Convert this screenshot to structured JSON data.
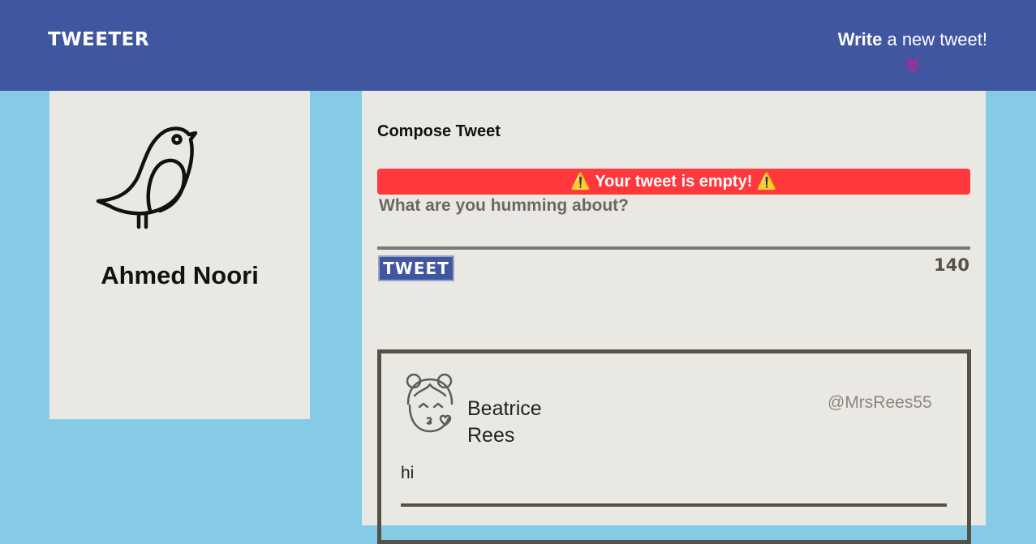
{
  "header": {
    "brand": "TWEETER",
    "write_bold": "Write",
    "write_rest": " a new tweet!"
  },
  "profile": {
    "name": "Ahmed Noori"
  },
  "compose": {
    "title": "Compose Tweet",
    "error": "⚠️ Your tweet is empty! ⚠️",
    "placeholder": "What are you humming about?",
    "button_label": "TWEET",
    "counter": "140"
  },
  "tweets": [
    {
      "name": "Beatrice Rees",
      "handle": "@MrsRees55",
      "text": "hi"
    }
  ],
  "icons": {
    "profile_avatar": "bird-icon",
    "toggle": "double-chevron-down-icon",
    "tweet_avatar": "girl-kiss-icon"
  },
  "colors": {
    "nav": "#4056a1",
    "page_bg": "#86cbe5",
    "panel_bg": "#eae8e3",
    "error": "#fe383c",
    "accent": "#c2218e"
  }
}
